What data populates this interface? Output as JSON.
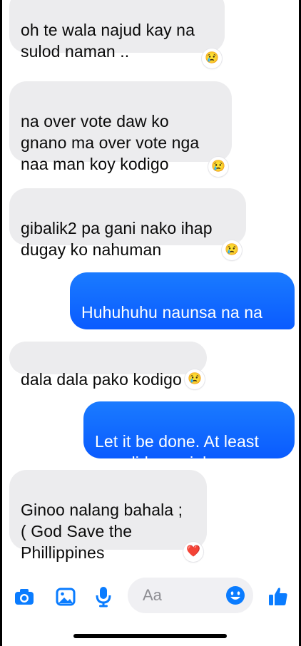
{
  "messages": [
    {
      "side": "in",
      "text": "oh te wala najud kay na\nsulod naman ..",
      "reaction": "😢"
    },
    {
      "side": "in",
      "text": "na over vote daw ko\ngnano ma over vote nga\nnaa man koy kodigo",
      "reaction": "😢"
    },
    {
      "side": "in",
      "text": "gibalik2 pa gani nako ihap\ndugay ko nahuman",
      "reaction": "😢"
    },
    {
      "side": "out",
      "text": "Huhuhuhu naunsa na na",
      "reaction": ""
    },
    {
      "side": "in",
      "text": "dala dala pako kodigo",
      "reaction": "😢"
    },
    {
      "side": "out",
      "text": "Let it be done.  At least\nyou did your job.",
      "reaction": ""
    },
    {
      "side": "in",
      "text": "Ginoo nalang bahala ;\n( God Save the\nPhillippines",
      "reaction": "❤️"
    }
  ],
  "composer": {
    "placeholder": "Aa"
  },
  "icons": {
    "camera": "camera-icon",
    "gallery": "gallery-icon",
    "mic": "microphone-icon",
    "emoji": "emoji-icon",
    "like": "thumbs-up-icon"
  },
  "colors": {
    "accent": "#0a7cff",
    "incoming": "#ececee",
    "outgoing": "#0a5bff"
  }
}
